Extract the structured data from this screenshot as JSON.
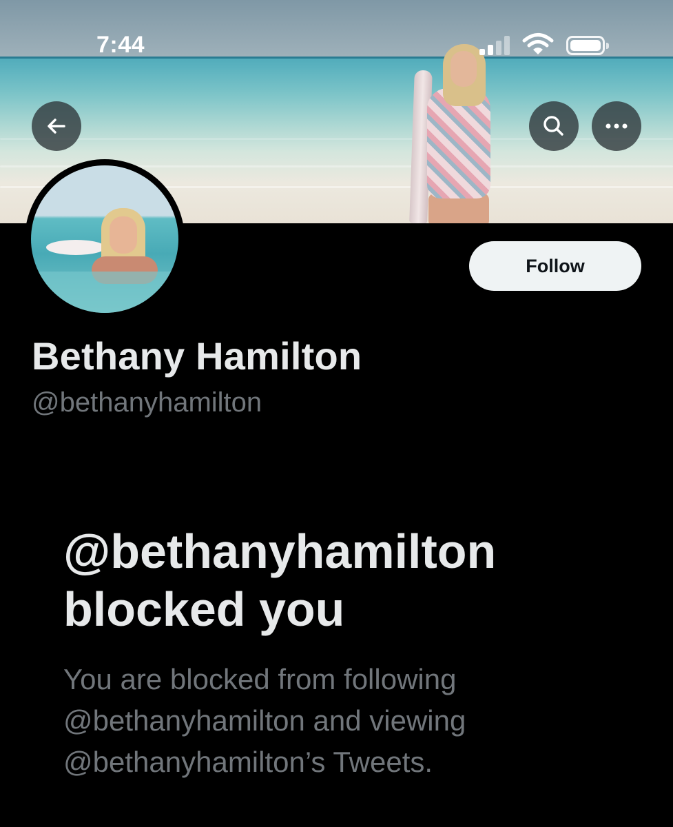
{
  "status_bar": {
    "time": "7:44"
  },
  "header": {
    "back_icon": "arrow-left-icon",
    "search_icon": "search-icon",
    "more_icon": "more-horizontal-icon"
  },
  "profile": {
    "display_name": "Bethany Hamilton",
    "handle": "@bethanyhamilton",
    "follow_label": "Follow"
  },
  "blocked": {
    "title": "@bethanyhamilton blocked you",
    "description": "You are blocked from following @bethanyhamilton and viewing @bethanyhamilton’s Tweets."
  },
  "colors": {
    "background": "#000000",
    "primary_text": "#e7e9ea",
    "secondary_text": "#71767b",
    "follow_button_bg": "#eff3f4"
  }
}
